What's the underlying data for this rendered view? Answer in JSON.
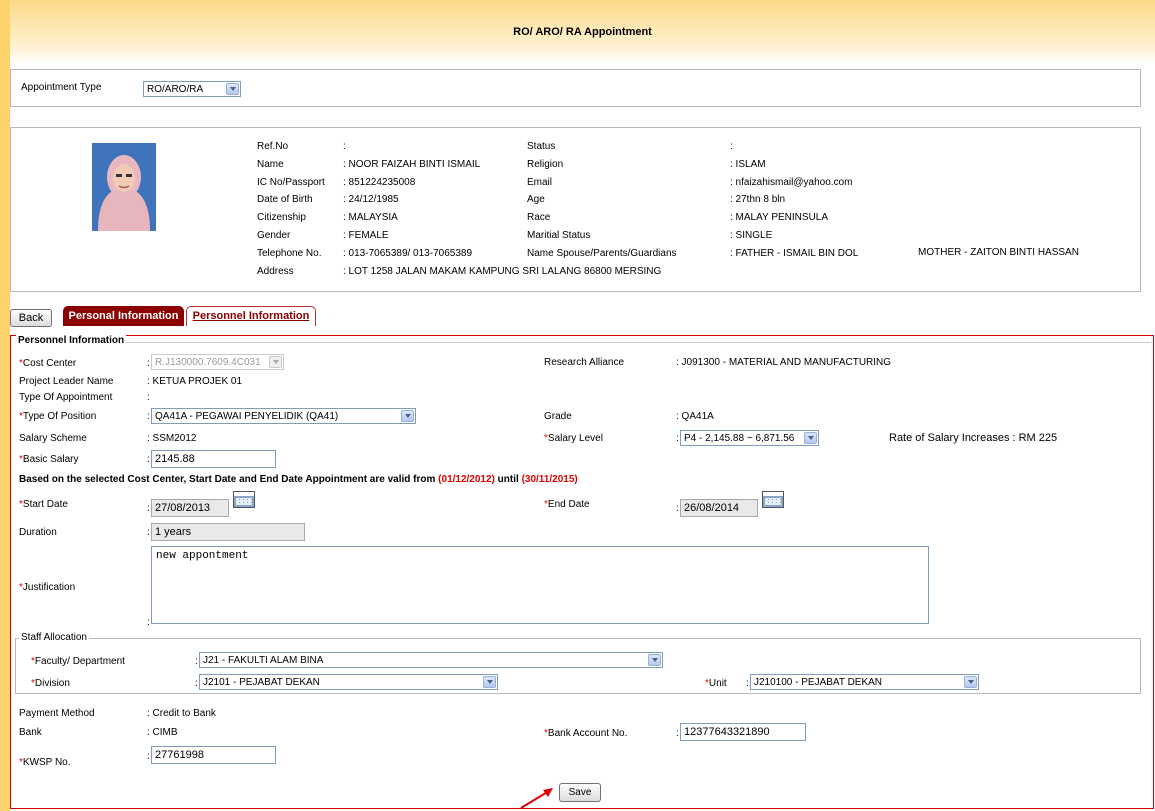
{
  "header": {
    "title": "RO/ ARO/ RA Appointment"
  },
  "appointment": {
    "label": "Appointment Type",
    "value": "RO/ARO/RA"
  },
  "profile": {
    "photo_desc": "photo-icon",
    "left": [
      {
        "label": "Ref.No",
        "value": ":"
      },
      {
        "label": "Name",
        "value": ": NOOR FAIZAH BINTI ISMAIL"
      },
      {
        "label": "IC No/Passport",
        "value": ": 851224235008"
      },
      {
        "label": "Date of Birth",
        "value": ": 24/12/1985"
      },
      {
        "label": "Citizenship",
        "value": ": MALAYSIA"
      },
      {
        "label": "Gender",
        "value": ": FEMALE"
      },
      {
        "label": "Telephone No.",
        "value": ": 013-7065389/ 013-7065389"
      },
      {
        "label": "Address",
        "value": ": LOT 1258 JALAN MAKAM KAMPUNG SRI LALANG 86800 MERSING"
      }
    ],
    "right": [
      {
        "label": "Status",
        "value": ":"
      },
      {
        "label": "Religion",
        "value": ": ISLAM"
      },
      {
        "label": "Email",
        "value": ": nfaizahismail@yahoo.com"
      },
      {
        "label": "Age",
        "value": ": 27thn 8 bln"
      },
      {
        "label": "Race",
        "value": ": MALAY PENINSULA"
      },
      {
        "label": "Maritial Status",
        "value": ": SINGLE"
      },
      {
        "label": "Name Spouse/Parents/Guardians",
        "value": ":  FATHER - ISMAIL BIN DOL"
      }
    ],
    "mother": "MOTHER - ZAITON BINTI HASSAN"
  },
  "tabs": {
    "back": "Back",
    "personal": "Personal Information",
    "personnel": "Personnel Information"
  },
  "form": {
    "legend": "Personnel Information",
    "cost_center": {
      "label": "Cost Center",
      "value": "R.J130000.7609.4C031"
    },
    "research_alliance": {
      "label": "Research Alliance",
      "value": ": J091300 - MATERIAL AND MANUFACTURING"
    },
    "project_leader": {
      "label": "Project Leader Name",
      "value": ": KETUA PROJEK 01"
    },
    "type_appointment": {
      "label": "Type Of Appointment",
      "value": ":"
    },
    "position": {
      "label": "Type Of Position",
      "value": "QA41A - PEGAWAI PENYELIDIK (QA41)"
    },
    "grade": {
      "label": "Grade",
      "value": ": QA41A"
    },
    "salary_scheme": {
      "label": "Salary Scheme",
      "value": ": SSM2012"
    },
    "salary_level": {
      "label": "Salary Level",
      "value": "P4 - 2,145.88 ~ 6,871.56"
    },
    "rate_increase": "Rate of Salary Increases : RM 225",
    "basic_salary": {
      "label": "Basic Salary",
      "value": "2145.88"
    },
    "notice": {
      "prefix": "Based on the selected Cost Center, Start Date and End Date Appointment are valid from ",
      "from": "(01/12/2012)",
      "mid": " until ",
      "until": "(30/11/2015)"
    },
    "start_date": {
      "label": "Start Date",
      "value": "27/08/2013"
    },
    "end_date": {
      "label": "End Date",
      "value": "26/08/2014"
    },
    "duration": {
      "label": "Duration",
      "value": "1 years"
    },
    "justification": {
      "label": "Justification",
      "value": "new appontment"
    },
    "staff_allocation": {
      "legend": "Staff Allocation",
      "faculty": {
        "label": "Faculty/ Department",
        "value": "J21 - FAKULTI ALAM BINA"
      },
      "division": {
        "label": "Division",
        "value": "J2101 - PEJABAT DEKAN"
      },
      "unit": {
        "label": "Unit",
        "value": "J210100 - PEJABAT DEKAN"
      }
    },
    "payment_method": {
      "label": "Payment Method",
      "value": ": Credit to Bank"
    },
    "bank": {
      "label": "Bank",
      "value": ": CIMB"
    },
    "bank_account": {
      "label": "Bank Account No.",
      "value": "12377643321890"
    },
    "kwsp": {
      "label": "KWSP No.",
      "value": "27761998"
    },
    "save": "Save",
    "colon": ":",
    "required": "*"
  },
  "colors": {
    "tab_active": "#8b0000",
    "border_red": "#d40000",
    "accent_bg": "#fbd36a"
  }
}
